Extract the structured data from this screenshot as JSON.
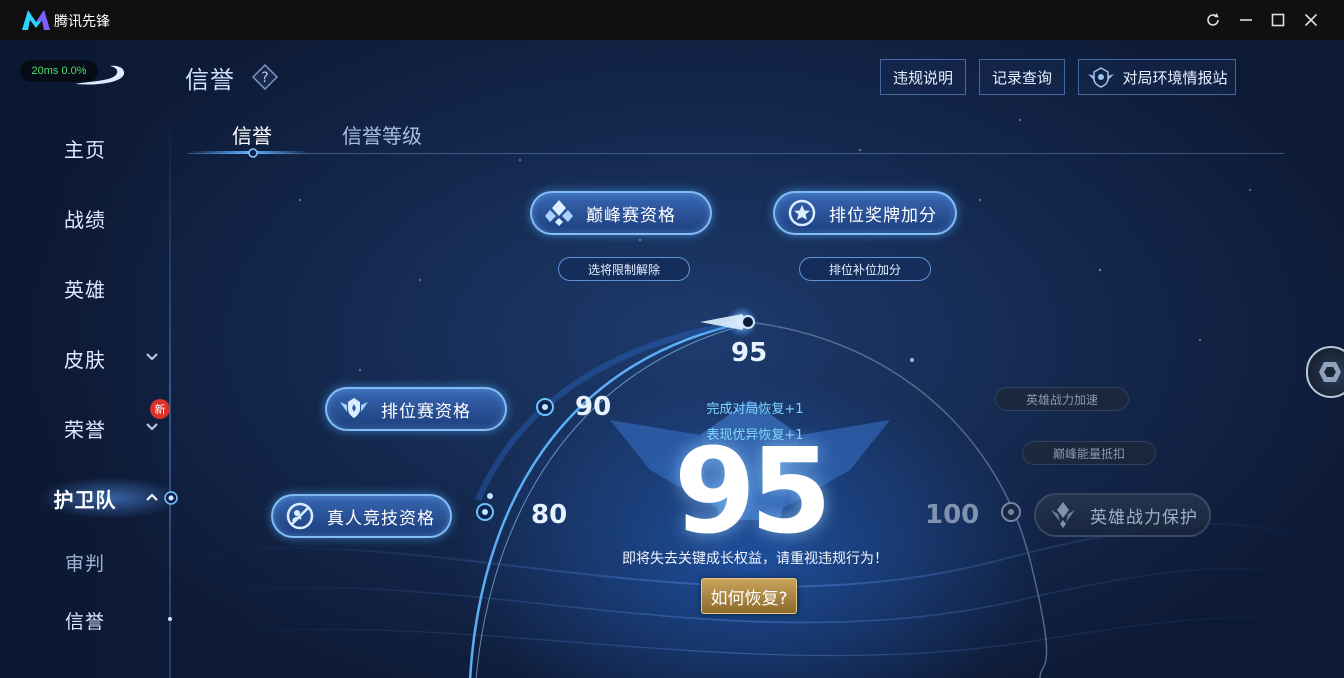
{
  "titlebar": {
    "app_title": "腾讯先锋"
  },
  "status": {
    "ping": "20ms",
    "loss": "0.0%"
  },
  "sidebar": {
    "items": [
      {
        "label": "主页"
      },
      {
        "label": "战绩"
      },
      {
        "label": "英雄"
      },
      {
        "label": "皮肤"
      },
      {
        "label": "荣誉"
      },
      {
        "label": "护卫队"
      },
      {
        "label": "审判"
      },
      {
        "label": "信誉"
      }
    ],
    "new_badge": "新"
  },
  "header": {
    "title": "信誉",
    "help_glyph": "?",
    "buttons": {
      "rules": "违规说明",
      "records": "记录查询",
      "station": "对局环境情报站"
    }
  },
  "tabs": [
    {
      "label": "信誉",
      "active": true
    },
    {
      "label": "信誉等级",
      "active": false
    }
  ],
  "privileges": {
    "peak": {
      "label": "巅峰赛资格",
      "sub": "选将限制解除"
    },
    "medal": {
      "label": "排位奖牌加分",
      "sub": "排位补位加分"
    },
    "ranked": {
      "label": "排位赛资格"
    },
    "realperson": {
      "label": "真人竞技资格"
    },
    "power_protect": {
      "label": "英雄战力保护",
      "sub1": "英雄战力加速",
      "sub2": "巅峰能量抵扣"
    }
  },
  "marks": {
    "m95": "95",
    "m90": "90",
    "m80": "80",
    "m100": "100"
  },
  "score": {
    "value": "95",
    "recover_1": "完成对局恢复+1",
    "recover_2": "表现优异恢复+1",
    "warning": "即将失去关键成长权益，请重视违规行为！",
    "how_button": "如何恢复?"
  },
  "colors": {
    "accent": "#5fb0ff",
    "gold_button": "#c8a35b",
    "badge_red": "#d8322a",
    "ping_green": "#4fe06a"
  }
}
